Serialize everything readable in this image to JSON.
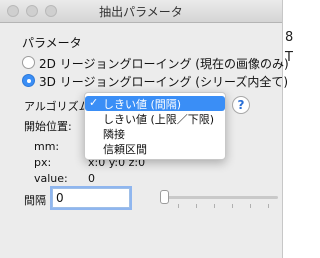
{
  "window": {
    "title": "抽出パラメータ"
  },
  "background": {
    "fragment_1": "8",
    "fragment_2": "T"
  },
  "params": {
    "section_label": "パラメータ",
    "radio_2d_label": "2D リージョングローイング (現在の画像のみ)",
    "radio_3d_label": "3D リージョングローイング (シリーズ内全て)",
    "algorithm_label": "アルゴリズム:",
    "start_position_label": "開始位置:",
    "mm_label": "mm:",
    "px_label": "px:",
    "px_value": "x:0 y:0 z:0",
    "value_label": "value:",
    "value_value": "0",
    "interval_label": "間隔",
    "interval_value": "0",
    "help_label": "?"
  },
  "menu": {
    "items": [
      {
        "label": "しきい値 (間隔)",
        "checked": true
      },
      {
        "label": "しきい値 (上限／下限)",
        "checked": false
      },
      {
        "label": "隣接",
        "checked": false
      },
      {
        "label": "信頼区間",
        "checked": false
      }
    ],
    "check_mark": "✓"
  },
  "colors": {
    "accent": "#3a8ef6",
    "window_bg": "#ececec"
  }
}
